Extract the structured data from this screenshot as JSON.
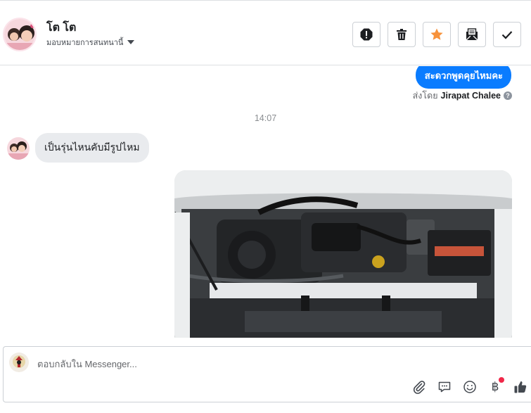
{
  "header": {
    "contact_name": "โต โต",
    "assign_label": "มอบหมายการสนทนานี้",
    "actions": [
      {
        "icon": "alert-icon"
      },
      {
        "icon": "trash-icon"
      },
      {
        "icon": "star-icon"
      },
      {
        "icon": "mark-unread-icon"
      },
      {
        "icon": "check-icon"
      }
    ],
    "star_color": "#f7923b"
  },
  "conversation": {
    "outgoing_message": "สะดวกพูดคุยไหมคะ",
    "sent_by_label": "ส่งโดย",
    "sent_by_name": "Jirapat Chalee",
    "timestamp": "14:07",
    "incoming_message": "เป็นรุ่นไหนคับมีรูปไหม",
    "photo_icon": "car-engine-photo",
    "accent_color": "#0a7cff"
  },
  "composer": {
    "placeholder": "ตอบกลับใน Messenger...",
    "tools": [
      "attach-icon",
      "saved-replies-icon",
      "emoji-icon",
      "payment-icon",
      "like-icon"
    ],
    "payment_symbol": "฿"
  }
}
